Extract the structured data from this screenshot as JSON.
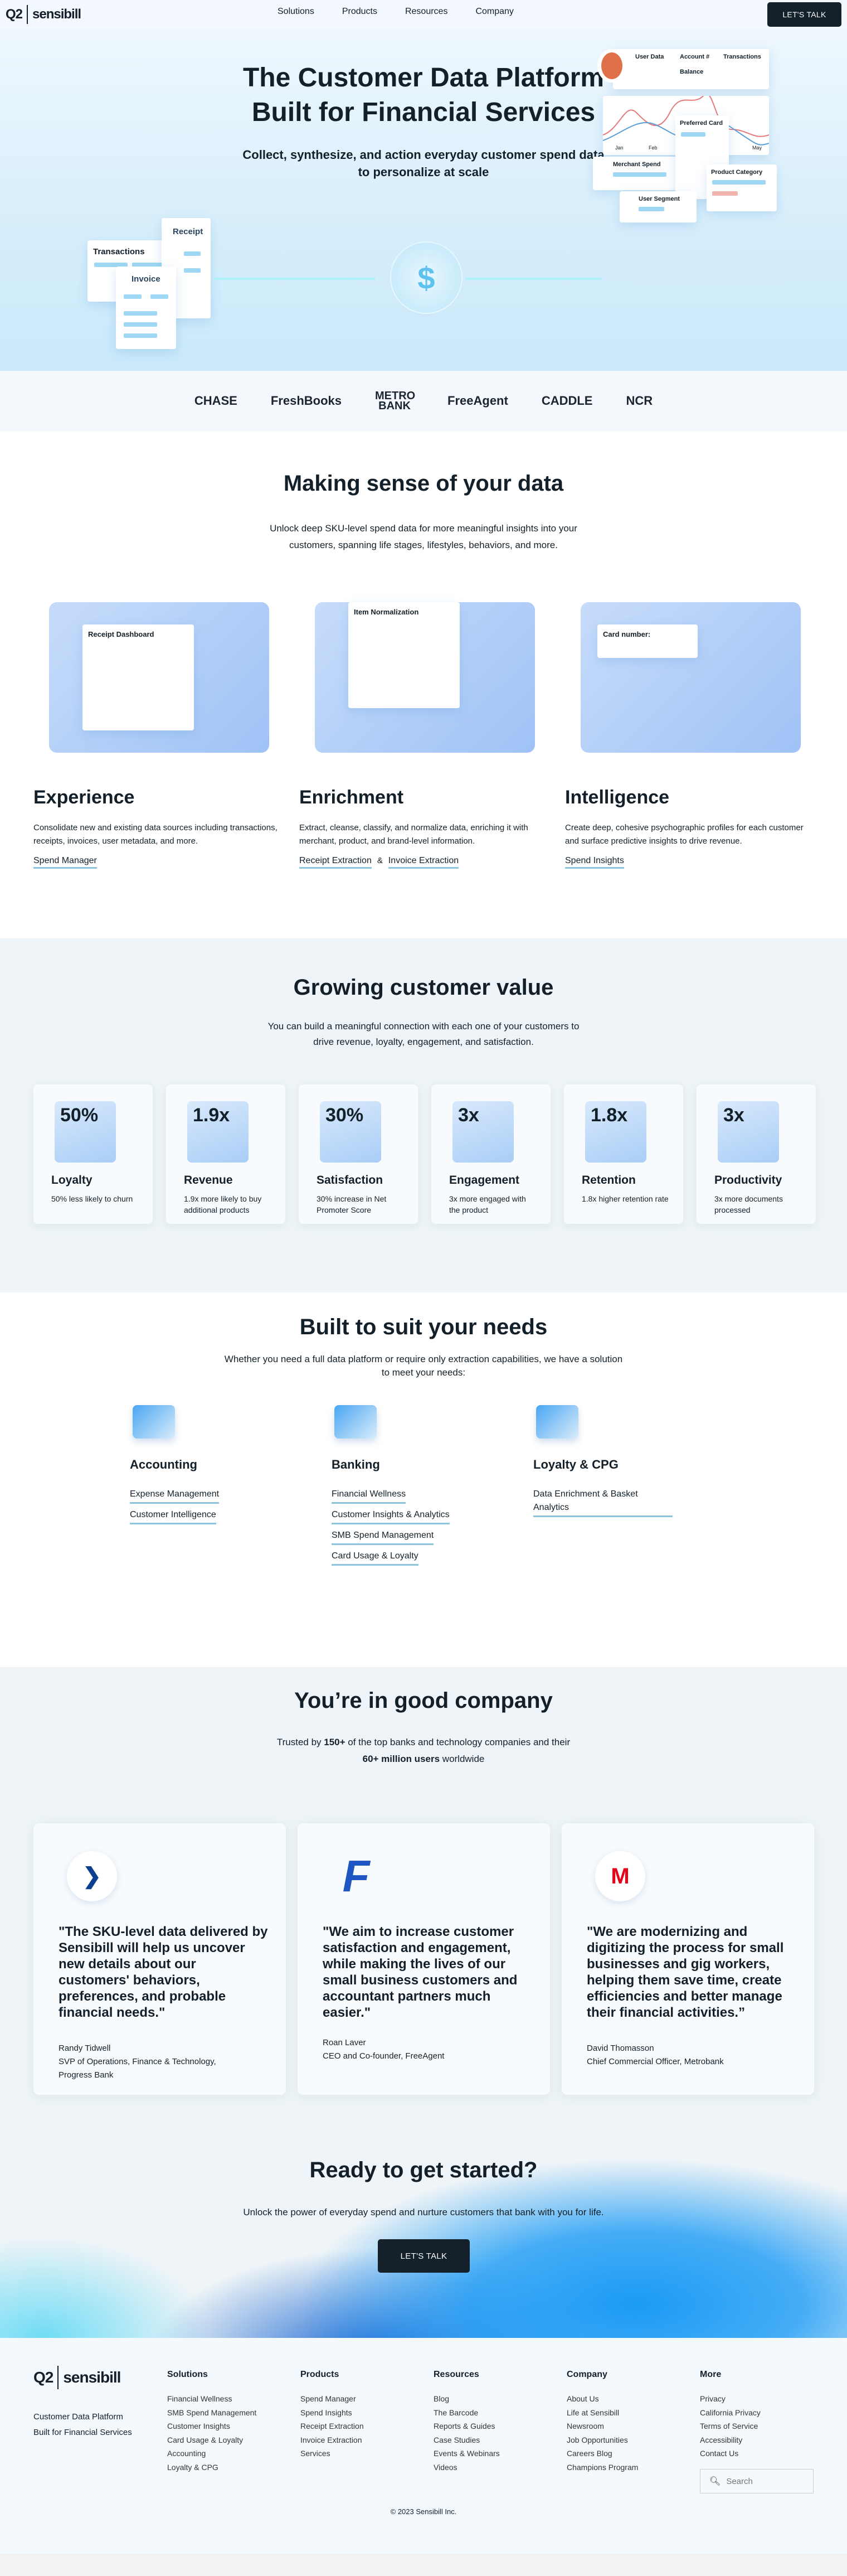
{
  "nav": {
    "brand_q2": "Q2",
    "brand_name": "sensibill",
    "links": [
      "Solutions",
      "Products",
      "Resources",
      "Company"
    ],
    "cta": "LET'S TALK"
  },
  "hero": {
    "title_line1": "The Customer Data Platform",
    "title_line2": "Built for Financial Services",
    "subtitle_line1": "Collect, synthesize, and action everyday customer spend data",
    "subtitle_line2": "to personalize at scale",
    "left_cards": {
      "transactions": "Transactions",
      "receipt": "Receipt",
      "invoice": "Invoice"
    },
    "right_cards": {
      "user_data": "User Data",
      "account": "Account #",
      "transactions": "Transactions",
      "balance": "Balance",
      "months": [
        "Jan",
        "Feb",
        "May"
      ],
      "preferred_card": "Preferred Card",
      "merchant_spend": "Merchant Spend",
      "product_category": "Product Category",
      "user_segment": "User Segment"
    }
  },
  "partner_logos": [
    "CHASE",
    "FreshBooks",
    "METRO BANK",
    "FreeAgent",
    "CADDLE",
    "NCR"
  ],
  "making_sense": {
    "title": "Making sense of your data",
    "subtitle_line1": "Unlock deep SKU-level spend data for more meaningful insights into your",
    "subtitle_line2": "customers, spanning life stages, lifestyles, behaviors, and more.",
    "features": [
      {
        "title": "Experience",
        "desc": "Consolidate new and existing data sources including transactions, receipts, invoices, user metadata, and more.",
        "links": [
          "Spend Manager"
        ],
        "img_label": "Receipt Dashboard"
      },
      {
        "title": "Enrichment",
        "desc": "Extract, cleanse, classify, and normalize data, enriching it with merchant, product, and brand-level information.",
        "links": [
          "Receipt Extraction",
          "Invoice Extraction"
        ],
        "separator": "&",
        "img_label": "Item Normalization"
      },
      {
        "title": "Intelligence",
        "desc": "Create deep, cohesive psychographic profiles for each customer and surface predictive insights to drive revenue.",
        "links": [
          "Spend Insights"
        ],
        "img_label": "Card number:"
      }
    ]
  },
  "growing": {
    "title": "Growing customer value",
    "subtitle_line1": "You can build a meaningful connection with each one of your customers to",
    "subtitle_line2": "drive revenue, loyalty, engagement, and satisfaction.",
    "stats": [
      {
        "value": "50%",
        "title": "Loyalty",
        "desc": "50% less likely to churn"
      },
      {
        "value": "1.9x",
        "title": "Revenue",
        "desc": "1.9x more likely to buy additional products"
      },
      {
        "value": "30%",
        "title": "Satisfaction",
        "desc": "30% increase in Net Promoter Score"
      },
      {
        "value": "3x",
        "title": "Engagement",
        "desc": "3x more engaged with the product"
      },
      {
        "value": "1.8x",
        "title": "Retention",
        "desc": "1.8x higher retention rate"
      },
      {
        "value": "3x",
        "title": "Productivity",
        "desc": "3x more documents processed"
      }
    ]
  },
  "needs": {
    "title": "Built to suit your needs",
    "subtitle_line1": "Whether you need a full data platform or require only extraction capabilities, we have a solution",
    "subtitle_line2": "to meet your needs:",
    "columns": [
      {
        "title": "Accounting",
        "icon": "receipt-user-icon",
        "links": [
          "Expense Management",
          "Customer Intelligence"
        ]
      },
      {
        "title": "Banking",
        "icon": "card-icon",
        "links": [
          "Financial Wellness",
          "Customer Insights & Analytics",
          "SMB Spend Management",
          "Card Usage & Loyalty"
        ]
      },
      {
        "title": "Loyalty & CPG",
        "icon": "basket-icon",
        "links": [
          "Data Enrichment & Basket Analytics"
        ]
      }
    ]
  },
  "company": {
    "title": "You’re in good company",
    "sub_pre": "Trusted by ",
    "sub_b1": "150+",
    "sub_mid": " of the top banks and technology companies and their ",
    "sub_b2": "60+ million users",
    "sub_post": " worldwide",
    "testimonials": [
      {
        "logo": "progress-bank-logo",
        "quote": "\"The SKU-level data delivered by Sensibill will help us uncover new details about our customers' behaviors, preferences, and probable financial needs.\"",
        "name": "Randy Tidwell",
        "role": "SVP of Operations, Finance & Technology, Progress Bank"
      },
      {
        "logo": "freeagent-logo",
        "quote": "\"We aim to increase customer satisfaction and engagement, while making the lives of our small business customers and accountant partners much easier.\"",
        "name": "Roan Laver",
        "role": "CEO and Co-founder, FreeAgent"
      },
      {
        "logo": "metrobank-logo",
        "quote": "\"We are modernizing and digitizing the process for small businesses and gig workers, helping them save time, create efficiencies and better manage their financial activities.”",
        "name": "David Thomasson",
        "role": "Chief Commercial Officer, Metrobank"
      }
    ]
  },
  "cta": {
    "title": "Ready to get started?",
    "subtitle": "Unlock the power of everyday spend and nurture customers that bank with you for life.",
    "button": "LET'S TALK"
  },
  "footer": {
    "tagline_line1": "Customer Data Platform",
    "tagline_line2": "Built for Financial Services",
    "columns": [
      {
        "title": "Solutions",
        "links": [
          "Financial Wellness",
          "SMB Spend Management",
          "Customer Insights",
          "Card Usage & Loyalty",
          "Accounting",
          "Loyalty & CPG"
        ]
      },
      {
        "title": "Products",
        "links": [
          "Spend Manager",
          "Spend Insights",
          "Receipt Extraction",
          "Invoice Extraction",
          "Services"
        ]
      },
      {
        "title": "Resources",
        "links": [
          "Blog",
          "The Barcode",
          "Reports & Guides",
          "Case Studies",
          "Events & Webinars",
          "Videos"
        ]
      },
      {
        "title": "Company",
        "links": [
          "About Us",
          "Life at Sensibill",
          "Newsroom",
          "Job Opportunities",
          "Careers Blog",
          "Champions Program"
        ]
      },
      {
        "title": "More",
        "links": [
          "Privacy",
          "California Privacy",
          "Terms of Service",
          "Accessibility",
          "Contact Us"
        ]
      }
    ],
    "search_placeholder": "Search",
    "copyright": "© 2023 Sensibill Inc."
  },
  "colors": {
    "dark": "#14202a",
    "accent_underline": "#8cc4dc",
    "hero_blue": "#c9e8fa",
    "cta_blue": "#1a8ff0"
  }
}
